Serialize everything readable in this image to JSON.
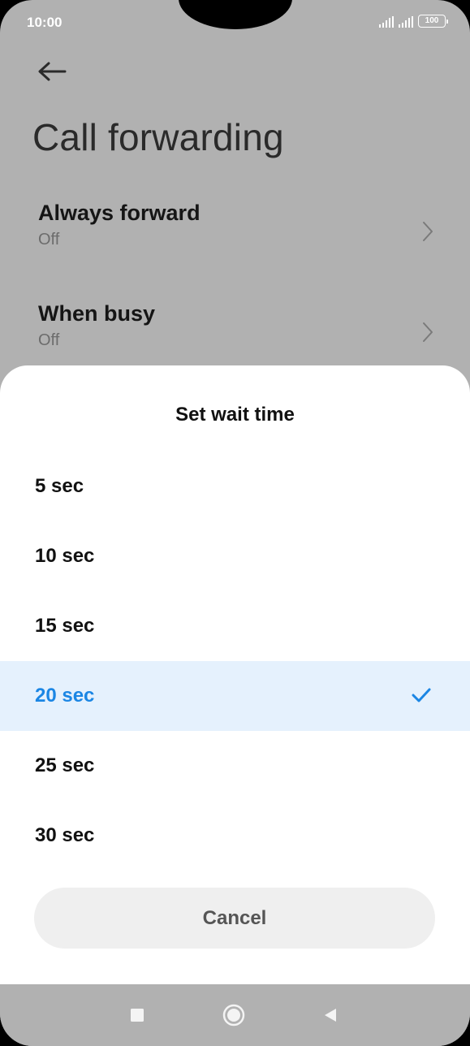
{
  "status_bar": {
    "time": "10:00",
    "battery": "100"
  },
  "page": {
    "title": "Call forwarding",
    "back_icon": "arrow-left-icon",
    "rows": [
      {
        "title": "Always forward",
        "subtitle": "Off",
        "icon": "chevron-right-icon"
      },
      {
        "title": "When busy",
        "subtitle": "Off",
        "icon": "chevron-right-icon"
      }
    ]
  },
  "dialog": {
    "title": "Set wait time",
    "options": [
      {
        "label": "5 sec",
        "selected": false
      },
      {
        "label": "10 sec",
        "selected": false
      },
      {
        "label": "15 sec",
        "selected": false
      },
      {
        "label": "20 sec",
        "selected": true
      },
      {
        "label": "25 sec",
        "selected": false
      },
      {
        "label": "30 sec",
        "selected": false
      }
    ],
    "cancel_label": "Cancel",
    "check_icon": "checkmark-icon"
  },
  "nav_bar": {
    "buttons": [
      "recents-icon",
      "home-icon",
      "back-triangle-icon"
    ]
  },
  "colors": {
    "accent": "#1b86e4",
    "selected_bg": "#e5f1fd",
    "scrim": "#b1b1b1"
  }
}
